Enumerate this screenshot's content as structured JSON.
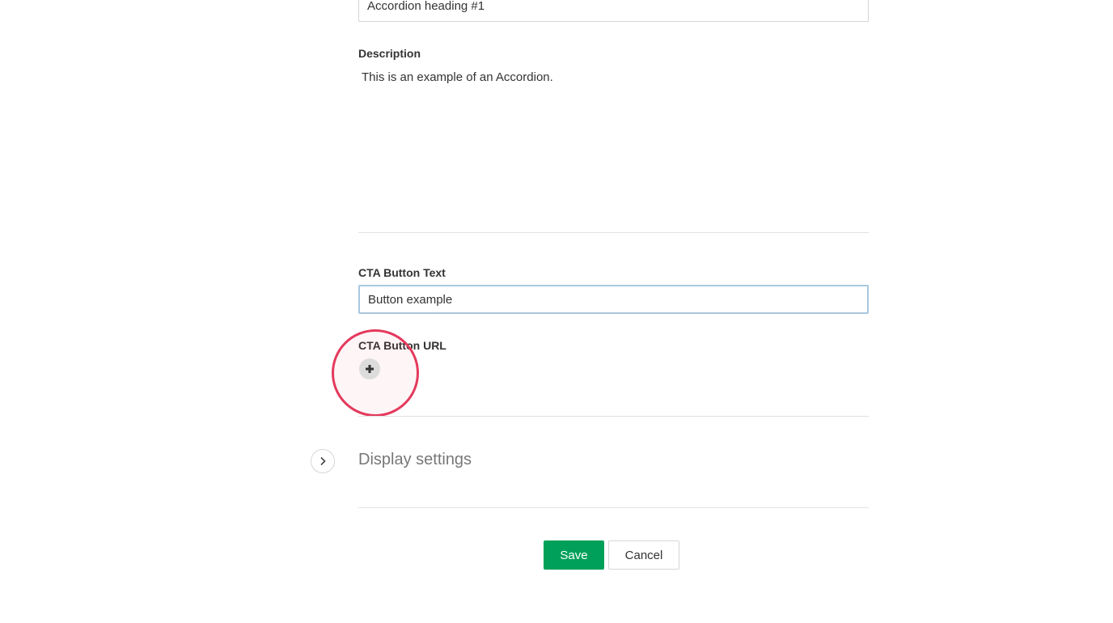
{
  "heading_field": {
    "value": "Accordion heading #1"
  },
  "description": {
    "label": "Description",
    "text": "This is an example of an Accordion."
  },
  "cta_text": {
    "label": "CTA Button Text",
    "value": "Button example"
  },
  "cta_url": {
    "label": "CTA Button URL",
    "add_icon": "plus-icon"
  },
  "display_settings": {
    "label": "Display settings",
    "toggle_icon": "chevron-right-icon"
  },
  "actions": {
    "save_label": "Save",
    "cancel_label": "Cancel"
  },
  "colors": {
    "accent": "#00a05a",
    "focus_border": "#a9c7de",
    "highlight_ring": "#e43a5c"
  }
}
